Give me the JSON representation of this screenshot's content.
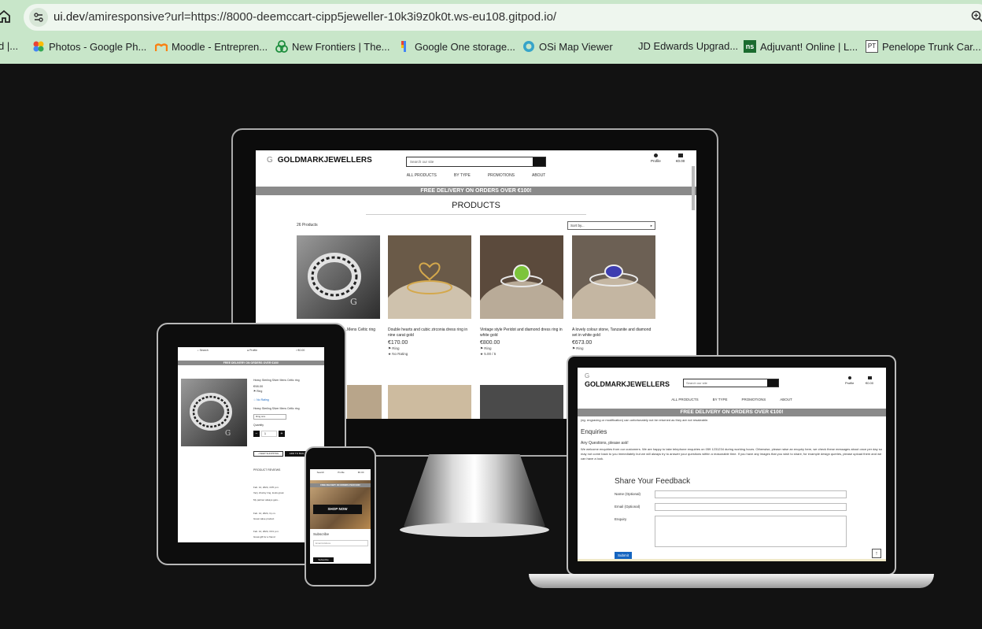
{
  "browser": {
    "url_prefix": "ui.dev",
    "url_rest": "/amiresponsive?url=https://8000-deemccart-cipp5jeweller-10k3i9z0k0t.ws-eu108.gitpod.io/",
    "bookmarks": [
      {
        "label": "d |..."
      },
      {
        "label": "Photos - Google Ph..."
      },
      {
        "label": "Moodle - Entrepren..."
      },
      {
        "label": "New Frontiers | The..."
      },
      {
        "label": "Google One storage..."
      },
      {
        "label": "OSi Map Viewer"
      },
      {
        "label": "JD Edwards Upgrad..."
      },
      {
        "label": "Adjuvant! Online | L..."
      },
      {
        "label": "Penelope Trunk Car..."
      }
    ]
  },
  "site": {
    "logo_mark": "G",
    "logo_text": "GOLDMARKJEWELLERS",
    "search_placeholder": "Search our site",
    "profile_label": "Profile",
    "bag_total": "€0.00",
    "nav": [
      "ALL PRODUCTS",
      "BY TYPE",
      "PROMOTIONS",
      "ABOUT"
    ],
    "banner": "FREE DELIVERY ON ORDERS OVER €100!"
  },
  "desktop": {
    "page_title": "PRODUCTS",
    "count": "26 Products",
    "sort_label": "Sort by...",
    "products": [
      {
        "title": "...Mens Celtic ring",
        "price": "",
        "type": "",
        "rating": ""
      },
      {
        "title": "Double hearts and cubic zirconia dress ring in nine carat gold",
        "price": "€170.00",
        "type": "Ring",
        "rating": "No Rating"
      },
      {
        "title": "Vintage style Peridot and diamond dress ring in white gold",
        "price": "€800.00",
        "type": "Ring",
        "rating": "5.00 / 5"
      },
      {
        "title": "A lovely colour stone, Tanzanite and diamond set in white gold",
        "price": "€673.00",
        "type": "Ring",
        "rating": ""
      }
    ]
  },
  "laptop": {
    "intro_text": "(eg. engraving or modification) can unfortunately not be returned as they are not resaleable.",
    "enquiries_heading": "Enquiries",
    "enquiries_sub": "Any Questions, please ask!",
    "enquiries_body": "We welcome enquiries from our customers. We are happy to take telephone enquiries on 059 1231234 during working hours. Otherwise, please raise an enquiry here, we check these messages about once per day so may not come back to you immediately but we will always try to answer your questions within a reasonable time. If you have any images that you wish to share, for example design queries, please upload them and we can have a look.",
    "form_title": "Share Your Feedback",
    "name_label": "Name (Optional)",
    "email_label": "Email (Optional)",
    "enquiry_label": "Enquiry",
    "submit_label": "Submit",
    "top_button": "↑"
  },
  "tablet": {
    "search_label": "Search",
    "product_title": "Heavy Sterling Silver Mens Celtic ring",
    "price": "€98.00",
    "type": "Ring",
    "rating": "No Rating",
    "description": "Heavy Sterling Silver Mens Celtic ring",
    "size_select": "Ring size",
    "quantity_label": "Quantity",
    "qty": "1",
    "keep_shopping": "KEEP SHOPPING",
    "add_to_bag": "ADD TO BAG",
    "reviews_heading": "PRODUCT REVIEWS",
    "reviews": [
      {
        "meta": "Feb. 12, 2024, 4:05 p.m.",
        "text": "Very chunky ring, looks great"
      },
      {
        "meta": "",
        "text": "My partner always gets..."
      },
      {
        "meta": "Feb. 12, 2024, 3 p.m.",
        "text": "Great value product"
      },
      {
        "meta": "Feb. 12, 2024, 3:01 p.m.",
        "text": "Great gift for a friend"
      }
    ]
  },
  "phone": {
    "shop_now": "SHOP NOW",
    "subscribe_heading": "Subscribe",
    "email_placeholder": "Email Address",
    "subscribe_button": "Subscribe"
  }
}
